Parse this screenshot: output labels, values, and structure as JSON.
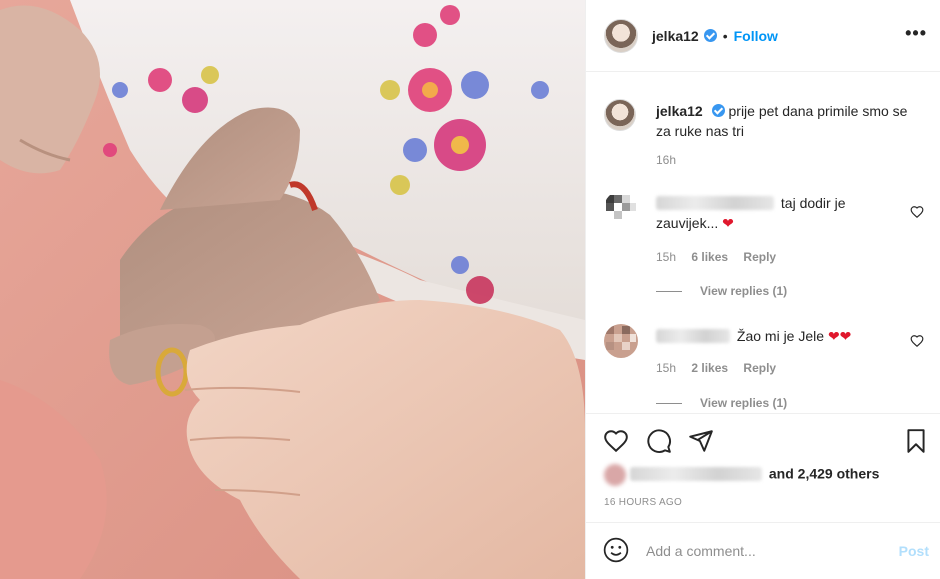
{
  "header": {
    "username": "jelka12",
    "separator": "•",
    "follow_label": "Follow",
    "more_label": "•••"
  },
  "caption": {
    "username": "jelka12",
    "text": "prije pet dana primile smo se za ruke nas tri",
    "time": "16h"
  },
  "comments": [
    {
      "text": "taj dodir je zauvijek...",
      "emoji": "❤",
      "time": "15h",
      "likes": "6 likes",
      "reply_label": "Reply",
      "view_replies": "View replies (1)"
    },
    {
      "text": "Žao mi je Jele",
      "emoji": "❤❤",
      "time": "15h",
      "likes": "2 likes",
      "reply_label": "Reply",
      "view_replies": "View replies (1)"
    }
  ],
  "actions": {
    "likes_suffix": "and 2,429 others",
    "time_ago": "16 HOURS AGO"
  },
  "add_comment": {
    "placeholder": "Add a comment...",
    "post_label": "Post"
  },
  "icons": {
    "like": "heart-icon",
    "comment": "comment-icon",
    "share": "share-icon",
    "save": "bookmark-icon",
    "emoji": "emoji-icon",
    "more": "more-icon"
  },
  "colors": {
    "link_blue": "#0095f6",
    "post_disabled": "#b2dffc",
    "verified": "#3897f0",
    "heart_red": "#e0182d",
    "muted": "#8e8e8e"
  }
}
